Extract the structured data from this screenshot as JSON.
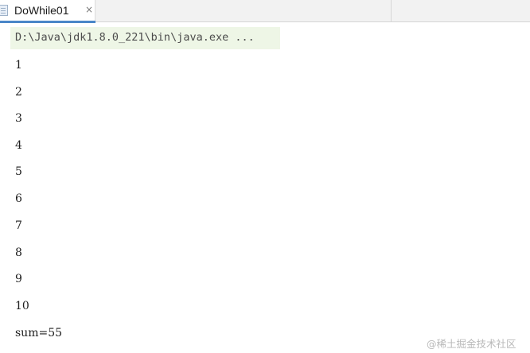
{
  "tab": {
    "label": "DoWhile01",
    "close_glyph": "×"
  },
  "console": {
    "command": "D:\\Java\\jdk1.8.0_221\\bin\\java.exe ...",
    "lines": [
      "1",
      "2",
      "3",
      "4",
      "5",
      "6",
      "7",
      "8",
      "9",
      "10",
      "sum=55"
    ]
  },
  "watermark": "@稀土掘金技术社区",
  "colors": {
    "tab_accent": "#4a86c8",
    "command_highlight": "#eef6e6",
    "tabbar_background": "#f2f2f2"
  },
  "icons": {
    "tab_file": "file-icon",
    "tab_close": "close-icon"
  }
}
